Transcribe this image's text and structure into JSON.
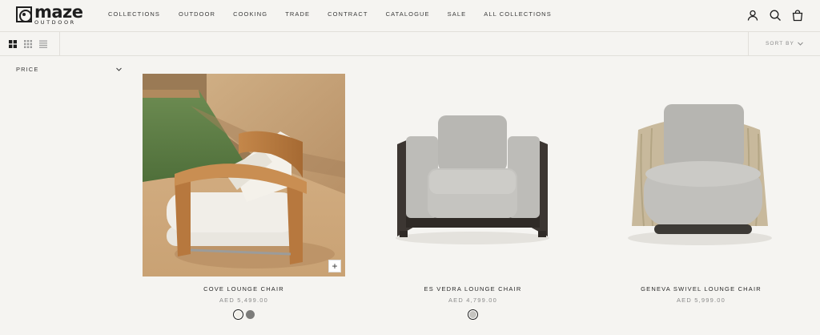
{
  "brand": {
    "name": "maze",
    "tagline": "OUTDOOR"
  },
  "nav": {
    "items": [
      {
        "label": "COLLECTIONS"
      },
      {
        "label": "OUTDOOR"
      },
      {
        "label": "COOKING"
      },
      {
        "label": "TRADE"
      },
      {
        "label": "CONTRACT"
      },
      {
        "label": "CATALOGUE"
      },
      {
        "label": "SALE"
      },
      {
        "label": "ALL COLLECTIONS"
      }
    ]
  },
  "header_icons": [
    "account-icon",
    "search-icon",
    "bag-icon"
  ],
  "toolbar": {
    "views": [
      "grid-large-icon",
      "grid-small-icon",
      "list-icon"
    ],
    "sort_label": "SORT BY"
  },
  "filters": {
    "price_label": "PRICE"
  },
  "products": [
    {
      "name": "COVE LOUNGE CHAIR",
      "price": "AED 5,499.00",
      "swatches": [
        {
          "color": "#f2f0ea",
          "selected": true
        },
        {
          "color": "#7c7c7a",
          "selected": false
        }
      ],
      "quick_add": "+"
    },
    {
      "name": "ES VEDRA LOUNGE CHAIR",
      "price": "AED 4,799.00",
      "swatches": [
        {
          "color": "#c5c4c0",
          "selected": true
        }
      ]
    },
    {
      "name": "GENEVA SWIVEL LOUNGE CHAIR",
      "price": "AED 5,999.00",
      "swatches": []
    }
  ],
  "colors": {
    "background": "#f5f4f1",
    "border": "#e1dfda",
    "text": "#2a2a2a",
    "muted": "#8a8a8a"
  }
}
